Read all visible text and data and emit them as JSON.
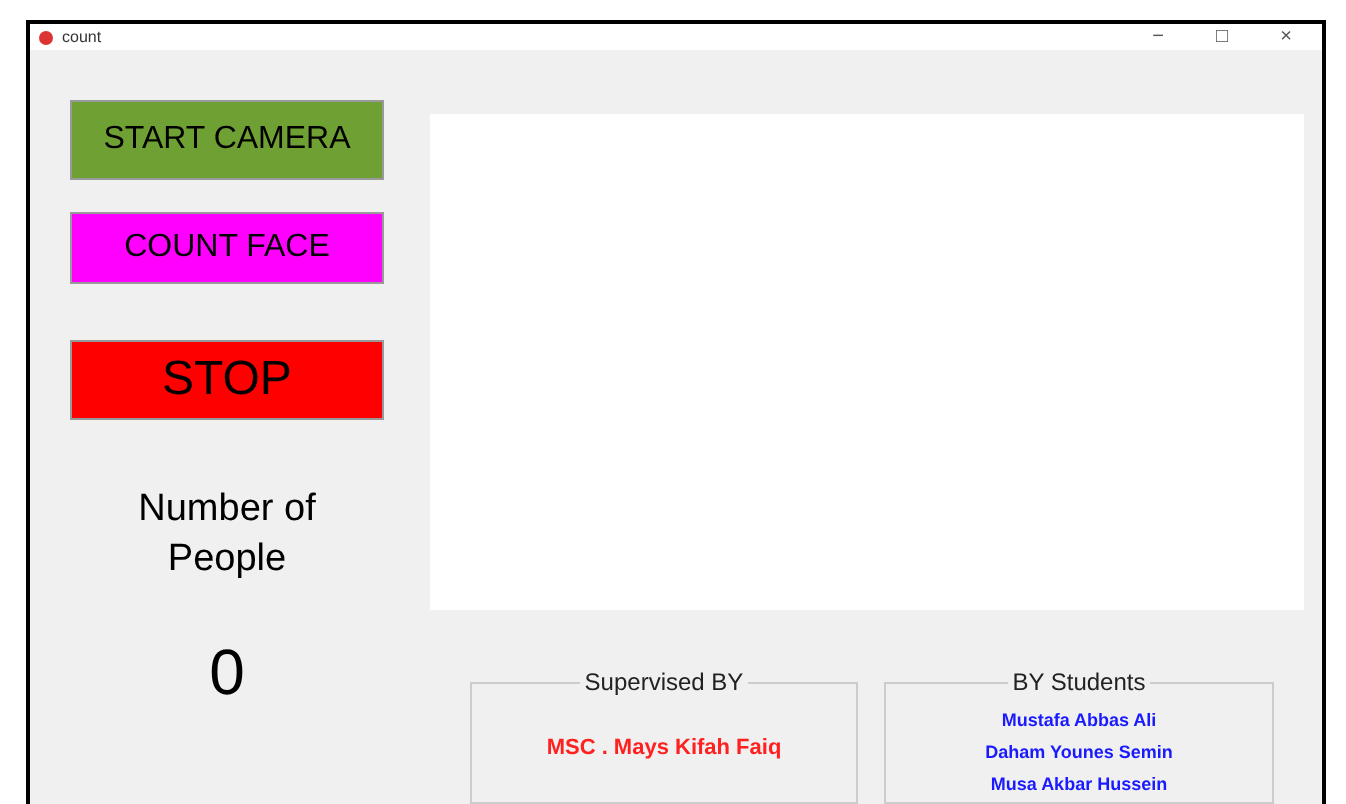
{
  "window": {
    "title": "count",
    "controls": [
      "−",
      "□",
      "×"
    ]
  },
  "buttons": [
    {
      "label": "START CAMERA",
      "color": "#6fa033"
    },
    {
      "label": "COUNT FACE",
      "color": "#ff00ff"
    },
    {
      "label": "STOP",
      "color": "#ff0000"
    }
  ],
  "counter": {
    "label": "Number of People",
    "value": "0"
  },
  "supervisor": {
    "title": "Supervised BY",
    "name": "MSC . Mays Kifah Faiq"
  },
  "students": {
    "title": "BY Students",
    "names": [
      "Mustafa Abbas Ali",
      "Daham Younes Semin",
      "Musa Akbar Hussein"
    ]
  }
}
